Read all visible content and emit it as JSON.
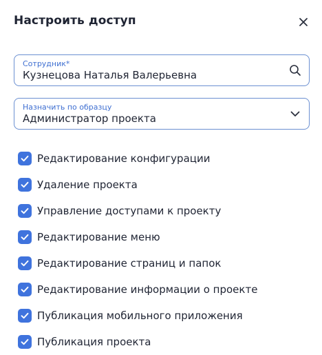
{
  "dialog": {
    "title": "Настроить доступ"
  },
  "employee_field": {
    "label": "Сотрудник*",
    "value": "Кузнецова Наталья Валерьевна"
  },
  "template_field": {
    "label": "Назначить по образцу",
    "value": "Администратор проекта"
  },
  "permissions": [
    {
      "label": "Редактирование конфигурации",
      "checked": true
    },
    {
      "label": "Удаление проекта",
      "checked": true
    },
    {
      "label": "Управление доступами к проекту",
      "checked": true
    },
    {
      "label": "Редактирование меню",
      "checked": true
    },
    {
      "label": "Редактирование страниц и папок",
      "checked": true
    },
    {
      "label": "Редактирование информации о проекте",
      "checked": true
    },
    {
      "label": "Публикация мобильного приложения",
      "checked": true
    },
    {
      "label": "Публикация проекта",
      "checked": true
    }
  ],
  "colors": {
    "accent": "#3f73dd",
    "field_border": "#6a8fd1",
    "text": "#1f2433"
  },
  "icons": {
    "close": "close-icon",
    "search": "search-icon",
    "dropdown": "chevron-down-icon",
    "checkbox": "checkmark-icon"
  }
}
